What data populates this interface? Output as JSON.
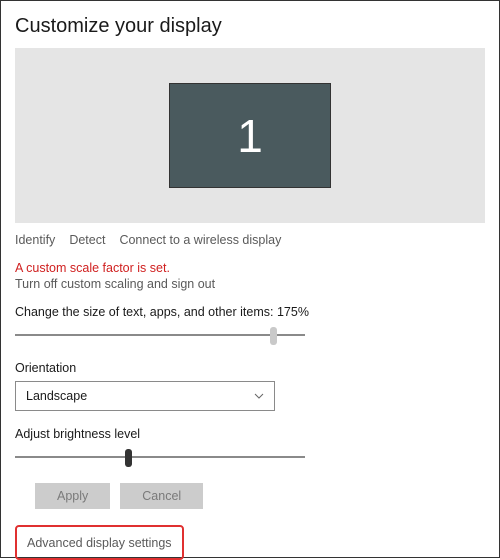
{
  "page_title": "Customize your display",
  "monitor": {
    "selected_label": "1"
  },
  "links": {
    "identify": "Identify",
    "detect": "Detect",
    "connect": "Connect to a wireless display"
  },
  "scale_warning": "A custom scale factor is set.",
  "turn_off_scaling": "Turn off custom scaling and sign out",
  "scale_label": "Change the size of text, apps, and other items: 175%",
  "scale_slider": {
    "position_pct": 88
  },
  "orientation": {
    "label": "Orientation",
    "value": "Landscape"
  },
  "brightness": {
    "label": "Adjust brightness level",
    "position_pct": 38
  },
  "buttons": {
    "apply": "Apply",
    "cancel": "Cancel"
  },
  "advanced_link": "Advanced display settings"
}
